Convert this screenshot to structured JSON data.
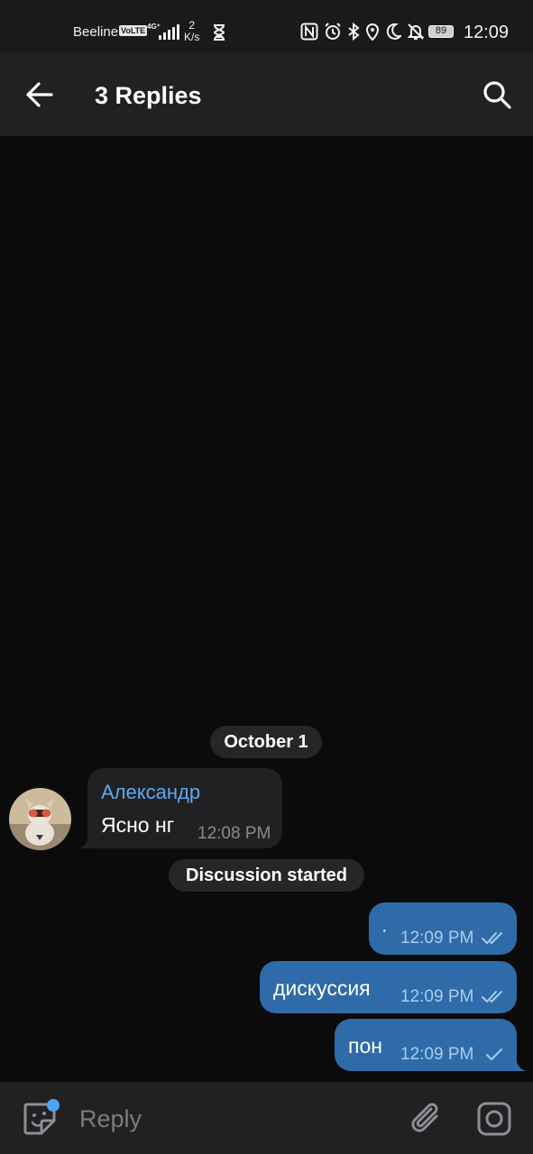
{
  "status_bar": {
    "carrier": "Beeline",
    "volte": "VoLTE",
    "network": "4G⁺",
    "speed_value": "2",
    "speed_unit": "K/s",
    "battery": "89",
    "time": "12:09"
  },
  "header": {
    "title": "3 Replies"
  },
  "chat": {
    "date_label": "October 1",
    "system_label": "Discussion started",
    "incoming": {
      "sender": "Александр",
      "text": "Ясно нг",
      "time": "12:08 PM"
    },
    "outgoing": [
      {
        "text": "·",
        "time": "12:09 PM",
        "status": "read"
      },
      {
        "text": "дискуссия",
        "time": "12:09 PM",
        "status": "read"
      },
      {
        "text": "пон",
        "time": "12:09 PM",
        "status": "sent"
      }
    ]
  },
  "composer": {
    "placeholder": "Reply"
  },
  "colors": {
    "accent": "#5ea9ee",
    "outgoing_bubble": "#2f6ba8",
    "incoming_bubble": "#212123",
    "background": "#0b0b0b"
  }
}
